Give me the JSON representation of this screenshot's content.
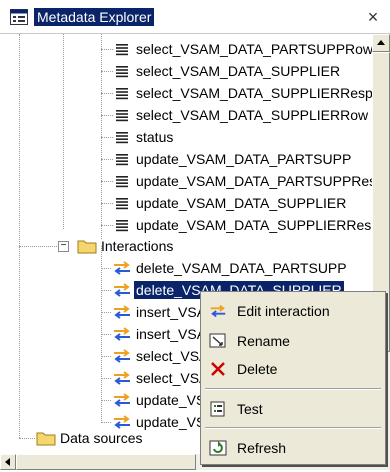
{
  "window": {
    "title": "Metadata Explorer",
    "close_glyph": "×",
    "icon": "app-window-icon"
  },
  "tree": {
    "records": [
      {
        "label": "select_VSAM_DATA_PARTSUPPRow",
        "icon": "record-icon"
      },
      {
        "label": "select_VSAM_DATA_SUPPLIER",
        "icon": "record-icon"
      },
      {
        "label": "select_VSAM_DATA_SUPPLIERRespo",
        "icon": "record-icon"
      },
      {
        "label": "select_VSAM_DATA_SUPPLIERRow",
        "icon": "record-icon"
      },
      {
        "label": "status",
        "icon": "record-icon"
      },
      {
        "label": "update_VSAM_DATA_PARTSUPP",
        "icon": "record-icon"
      },
      {
        "label": "update_VSAM_DATA_PARTSUPPRes",
        "icon": "record-icon"
      },
      {
        "label": "update_VSAM_DATA_SUPPLIER",
        "icon": "record-icon"
      },
      {
        "label": "update_VSAM_DATA_SUPPLIERResp",
        "icon": "record-icon"
      }
    ],
    "interactions_folder": {
      "label": "Interactions",
      "expander": "−",
      "icon": "folder-icon"
    },
    "interactions": [
      {
        "label": "delete_VSAM_DATA_PARTSUPP",
        "selected": false
      },
      {
        "label": "delete_VSAM_DATA_SUPPLIER",
        "selected": true
      },
      {
        "label": "insert_VSA",
        "selected": false
      },
      {
        "label": "insert_VSA",
        "selected": false
      },
      {
        "label": "select_VSA",
        "selected": false
      },
      {
        "label": "select_VSA",
        "selected": false
      },
      {
        "label": "update_VS",
        "selected": false
      },
      {
        "label": "update_VS",
        "selected": false
      }
    ],
    "data_sources": {
      "label": "Data sources",
      "icon": "folder-icon"
    }
  },
  "context_menu": {
    "items": [
      {
        "label": "Edit interaction",
        "icon": "interaction-icon"
      },
      {
        "label": "Rename",
        "icon": "rename-icon"
      },
      {
        "label": "Delete",
        "icon": "delete-x-icon"
      },
      {
        "label": "Test",
        "icon": "test-icon"
      },
      {
        "label": "Refresh",
        "icon": "refresh-icon"
      }
    ]
  },
  "colors": {
    "selection": "#0a246a",
    "menu_bg": "#ece9d8",
    "folder": "#f5d66c",
    "interaction_arrow": "#f0a020",
    "delete_x": "#cc0000"
  }
}
